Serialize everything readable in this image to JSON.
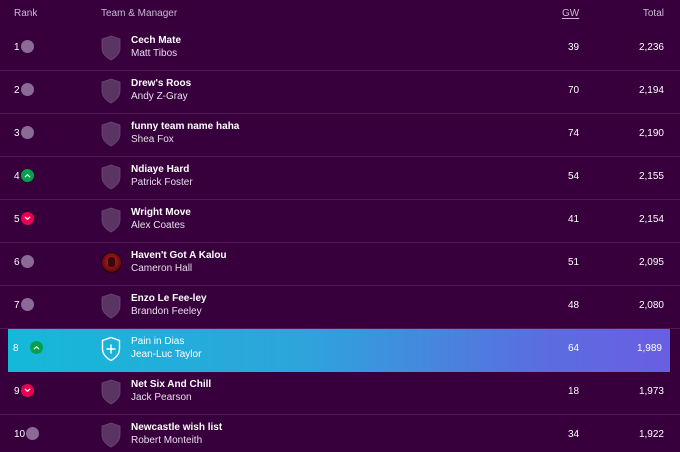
{
  "header": {
    "rank": "Rank",
    "team_manager": "Team & Manager",
    "gw": "GW",
    "total": "Total"
  },
  "colors": {
    "background": "#37003c",
    "move_up": "#01a14b",
    "move_down": "#e90052",
    "move_same": "#8b6a98",
    "highlight_start": "#14b9d8",
    "highlight_end": "#6a5ee3"
  },
  "entries": [
    {
      "rank": "1",
      "movement": "same",
      "team": "Cech Mate",
      "manager": "Matt Tibos",
      "gw": "39",
      "total": "2,236",
      "crest": "shield-icon"
    },
    {
      "rank": "2",
      "movement": "same",
      "team": "Drew's Roos",
      "manager": "Andy Z-Gray",
      "gw": "70",
      "total": "2,194",
      "crest": "shield-icon"
    },
    {
      "rank": "3",
      "movement": "same",
      "team": "funny team name haha",
      "manager": "Shea Fox",
      "gw": "74",
      "total": "2,190",
      "crest": "shield-icon"
    },
    {
      "rank": "4",
      "movement": "up",
      "team": "Ndiaye Hard",
      "manager": "Patrick Foster",
      "gw": "54",
      "total": "2,155",
      "crest": "shield-icon"
    },
    {
      "rank": "5",
      "movement": "down",
      "team": "Wright Move",
      "manager": "Alex Coates",
      "gw": "41",
      "total": "2,154",
      "crest": "shield-icon"
    },
    {
      "rank": "6",
      "movement": "same",
      "team": "Haven't Got A Kalou",
      "manager": "Cameron Hall",
      "gw": "51",
      "total": "2,095",
      "crest": "team-avatar"
    },
    {
      "rank": "7",
      "movement": "same",
      "team": "Enzo Le Fee-ley",
      "manager": "Brandon Feeley",
      "gw": "48",
      "total": "2,080",
      "crest": "shield-icon"
    },
    {
      "rank": "8",
      "movement": "up",
      "team": "Pain in Dias",
      "manager": "Jean-Luc Taylor",
      "gw": "64",
      "total": "1,989",
      "crest": "add-crest-icon",
      "highlight": true
    },
    {
      "rank": "9",
      "movement": "down",
      "team": "Net Six And Chill",
      "manager": "Jack Pearson",
      "gw": "18",
      "total": "1,973",
      "crest": "shield-icon"
    },
    {
      "rank": "10",
      "movement": "same",
      "team": "Newcastle wish list",
      "manager": "Robert Monteith",
      "gw": "34",
      "total": "1,922",
      "crest": "shield-icon"
    }
  ]
}
